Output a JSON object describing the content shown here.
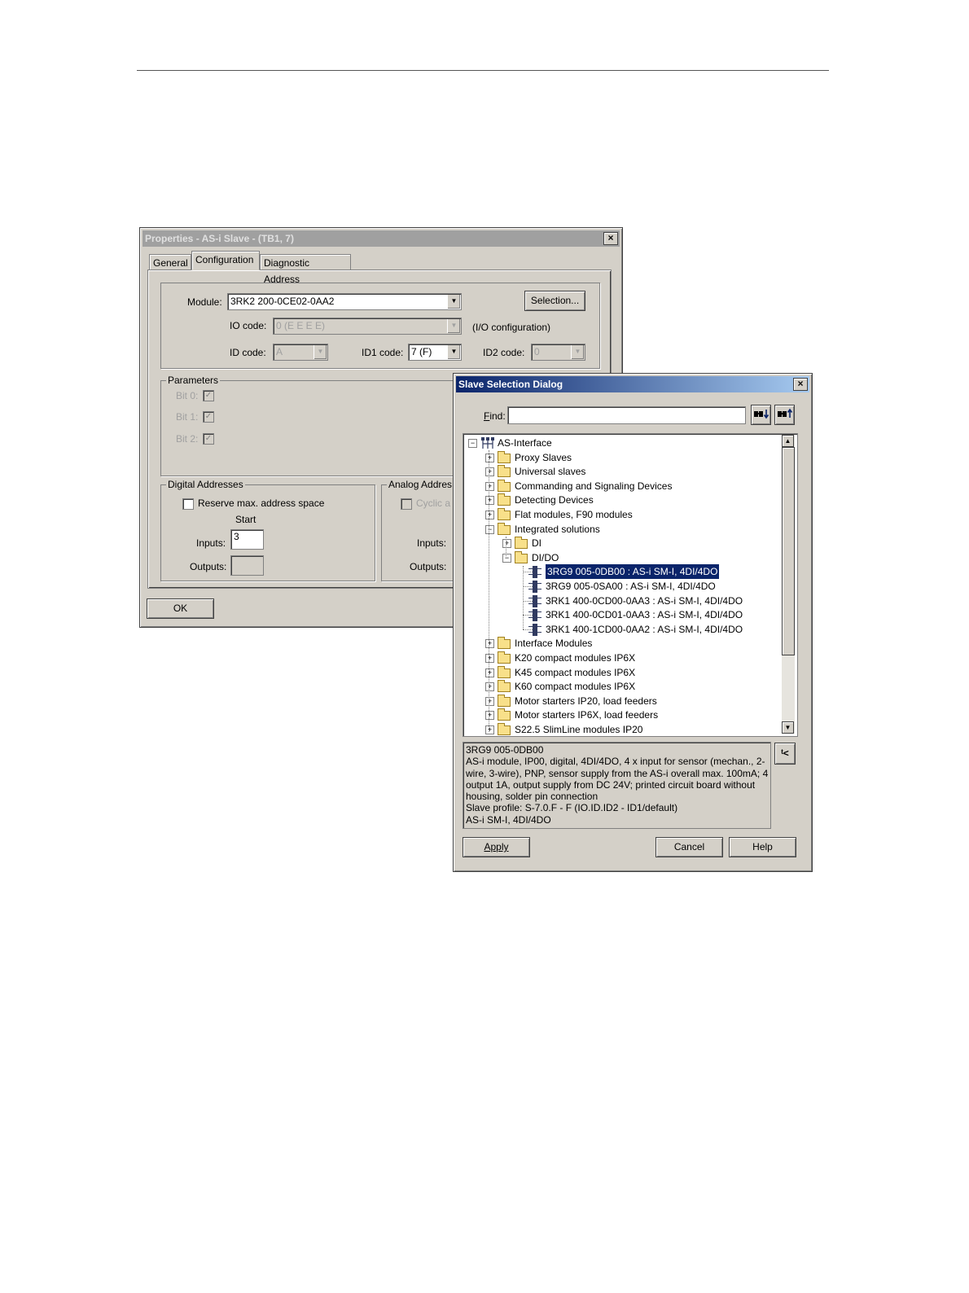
{
  "properties_dialog": {
    "title": "Properties - AS-i Slave - (TB1, 7)",
    "close": "×",
    "tabs": [
      "General",
      "Configuration",
      "Diagnostic Address"
    ],
    "module_label": "Module:",
    "module_value": "3RK2 200-0CE02-0AA2",
    "selection_button": "Selection...",
    "io_code_label": "IO code:",
    "io_code_value": "0  (E E E E)",
    "io_config_note": "(I/O configuration)",
    "id_code_label": "ID code:",
    "id_code_value": "A",
    "id1_code_label": "ID1 code:",
    "id1_code_value": "7  (F)",
    "id2_code_label": "ID2 code:",
    "id2_code_value": "0",
    "parameters_label": "Parameters",
    "bits": [
      "Bit 0:",
      "Bit 1:",
      "Bit 2:"
    ],
    "digital_addresses_label": "Digital Addresses",
    "reserve_label": "Reserve max. address space",
    "start_label": "Start",
    "inputs_label": "Inputs:",
    "inputs_value": "3",
    "outputs_label": "Outputs:",
    "outputs_value": "",
    "analog_addresses_label": "Analog Addres",
    "cyclic_label": "Cyclic a",
    "analog_inputs_label": "Inputs:",
    "analog_outputs_label": "Outputs:",
    "ok_button": "OK"
  },
  "slave_dialog": {
    "title": "Slave Selection Dialog",
    "close": "×",
    "find_label": "Find:",
    "find_value": "",
    "find_down_icon": "find-down-icon",
    "find_up_icon": "find-up-icon",
    "tree": [
      {
        "label": "AS-Interface",
        "kind": "root",
        "expander": "−"
      },
      {
        "label": "Proxy Slaves",
        "kind": "folder",
        "expander": "+"
      },
      {
        "label": "Universal slaves",
        "kind": "folder",
        "expander": "+"
      },
      {
        "label": "Commanding and Signaling Devices",
        "kind": "folder",
        "expander": "+"
      },
      {
        "label": "Detecting Devices",
        "kind": "folder",
        "expander": "+"
      },
      {
        "label": "Flat modules, F90 modules",
        "kind": "folder",
        "expander": "+"
      },
      {
        "label": "Integrated solutions",
        "kind": "folder",
        "expander": "−"
      },
      {
        "label": "DI",
        "kind": "folder",
        "expander": "+"
      },
      {
        "label": "DI/DO",
        "kind": "folder",
        "expander": "−"
      },
      {
        "label": "3RG9 005-0DB00 : AS-i SM-I, 4DI/4DO",
        "kind": "slave",
        "selected": true
      },
      {
        "label": "3RG9 005-0SA00 : AS-i SM-I, 4DI/4DO",
        "kind": "slave"
      },
      {
        "label": "3RK1 400-0CD00-0AA3 : AS-i SM-I, 4DI/4DO",
        "kind": "slave"
      },
      {
        "label": "3RK1 400-0CD01-0AA3 : AS-i SM-I, 4DI/4DO",
        "kind": "slave"
      },
      {
        "label": "3RK1 400-1CD00-0AA2 : AS-i SM-I, 4DI/4DO",
        "kind": "slave"
      },
      {
        "label": "Interface Modules",
        "kind": "folder",
        "expander": "+"
      },
      {
        "label": "K20 compact modules IP6X",
        "kind": "folder",
        "expander": "+"
      },
      {
        "label": "K45 compact modules IP6X",
        "kind": "folder",
        "expander": "+"
      },
      {
        "label": "K60 compact modules IP6X",
        "kind": "folder",
        "expander": "+"
      },
      {
        "label": "Motor starters IP20, load feeders",
        "kind": "folder",
        "expander": "+"
      },
      {
        "label": "Motor starters IP6X, load feeders",
        "kind": "folder",
        "expander": "+"
      },
      {
        "label": "S22.5 SlimLine modules IP20",
        "kind": "folder",
        "expander": "+"
      }
    ],
    "description": [
      "3RG9 005-0DB00",
      "AS-i module, IP00, digital, 4DI/4DO, 4 x input for sensor (mechan., 2-",
      "wire, 3-wire), PNP, sensor supply from the AS-i overall max. 100mA; 4 x",
      "output 1A, output supply from DC 24V; printed circuit board without",
      "housing, solder pin connection",
      "Slave profile: S-7.0.F - F   (IO.ID.ID2 - ID1/default)",
      "AS-i SM-I, 4DI/4DO"
    ],
    "apply_button": "Apply",
    "cancel_button": "Cancel",
    "help_button": "Help"
  }
}
